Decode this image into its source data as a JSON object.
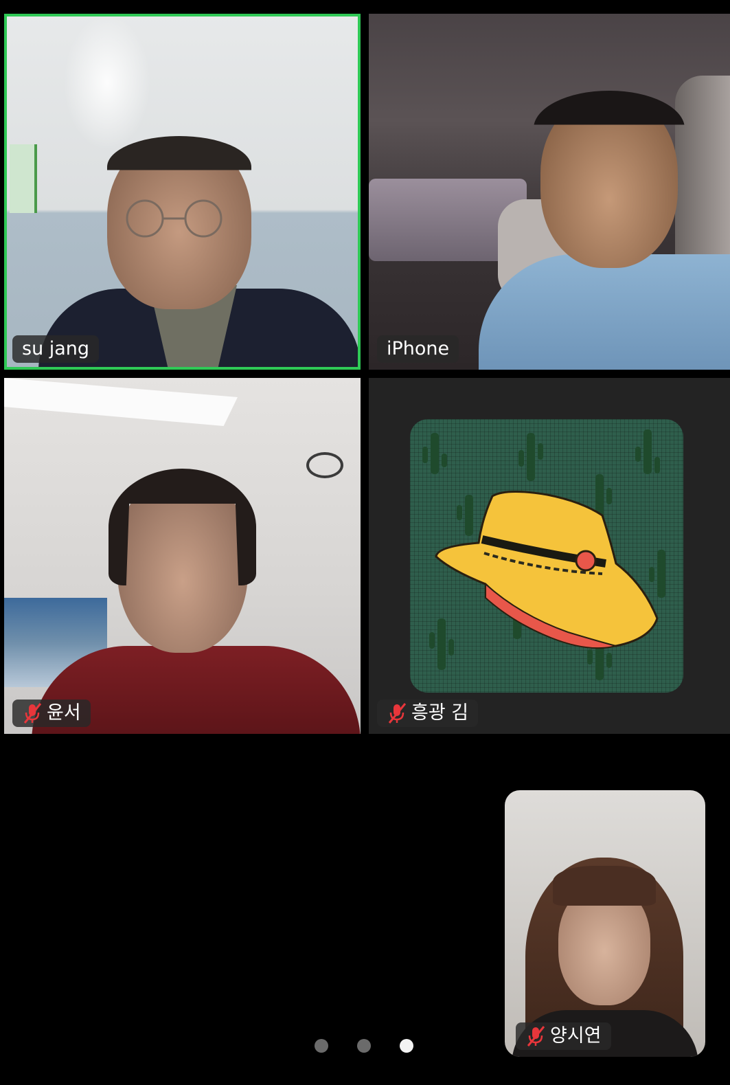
{
  "participants": [
    {
      "name": "su jang",
      "muted": false,
      "active_speaker": true,
      "video": "camera"
    },
    {
      "name": "iPhone",
      "muted": false,
      "active_speaker": false,
      "video": "camera"
    },
    {
      "name": "윤서",
      "muted": true,
      "active_speaker": false,
      "video": "camera"
    },
    {
      "name": "흥광 김",
      "muted": true,
      "active_speaker": false,
      "video": "avatar"
    }
  ],
  "self_view": {
    "name": "양시연",
    "muted": true
  },
  "pagination": {
    "pages": 3,
    "current_page": 3
  },
  "colors": {
    "active_speaker_border": "#2fc956",
    "muted_icon": "#e8363b",
    "background": "#000000"
  },
  "icons": {
    "muted": "mic-muted-icon"
  }
}
